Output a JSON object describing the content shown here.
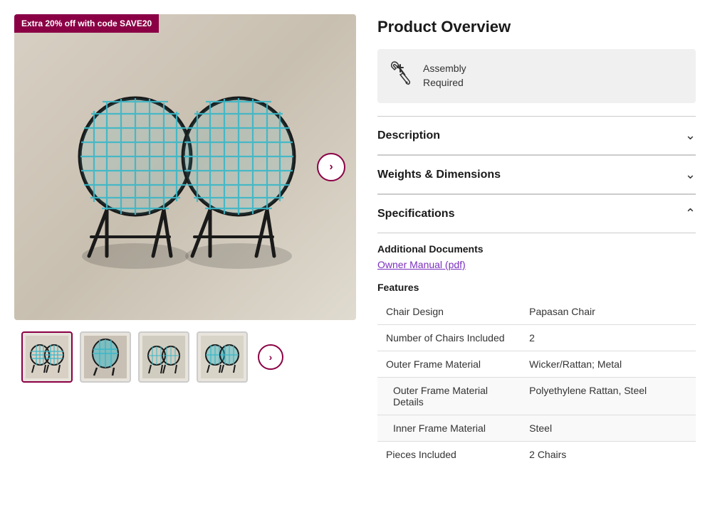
{
  "promo": {
    "badge": "Extra 20% off with code SAVE20"
  },
  "product": {
    "overview_title": "Product Overview",
    "assembly": {
      "line1": "Assembly",
      "line2": "Required"
    },
    "sections": [
      {
        "id": "description",
        "label": "Description",
        "expanded": false
      },
      {
        "id": "weights",
        "label": "Weights & Dimensions",
        "expanded": false
      },
      {
        "id": "specifications",
        "label": "Specifications",
        "expanded": true
      }
    ],
    "additional_docs_label": "Additional Documents",
    "owner_manual_link": "Owner Manual (pdf)",
    "features_label": "Features",
    "features_table": [
      {
        "key": "Chair Design",
        "value": "Papasan Chair",
        "indented": false
      },
      {
        "key": "Number of Chairs Included",
        "value": "2",
        "indented": false
      },
      {
        "key": "Outer Frame Material",
        "value": "Wicker/Rattan; Metal",
        "indented": false
      },
      {
        "key": "Outer Frame Material Details",
        "value": "Polyethylene Rattan, Steel",
        "indented": true
      },
      {
        "key": "Inner Frame Material",
        "value": "Steel",
        "indented": true
      },
      {
        "key": "Pieces Included",
        "value": "2 Chairs",
        "indented": false
      }
    ]
  },
  "nav": {
    "next_main": "›",
    "next_thumb": "›"
  }
}
